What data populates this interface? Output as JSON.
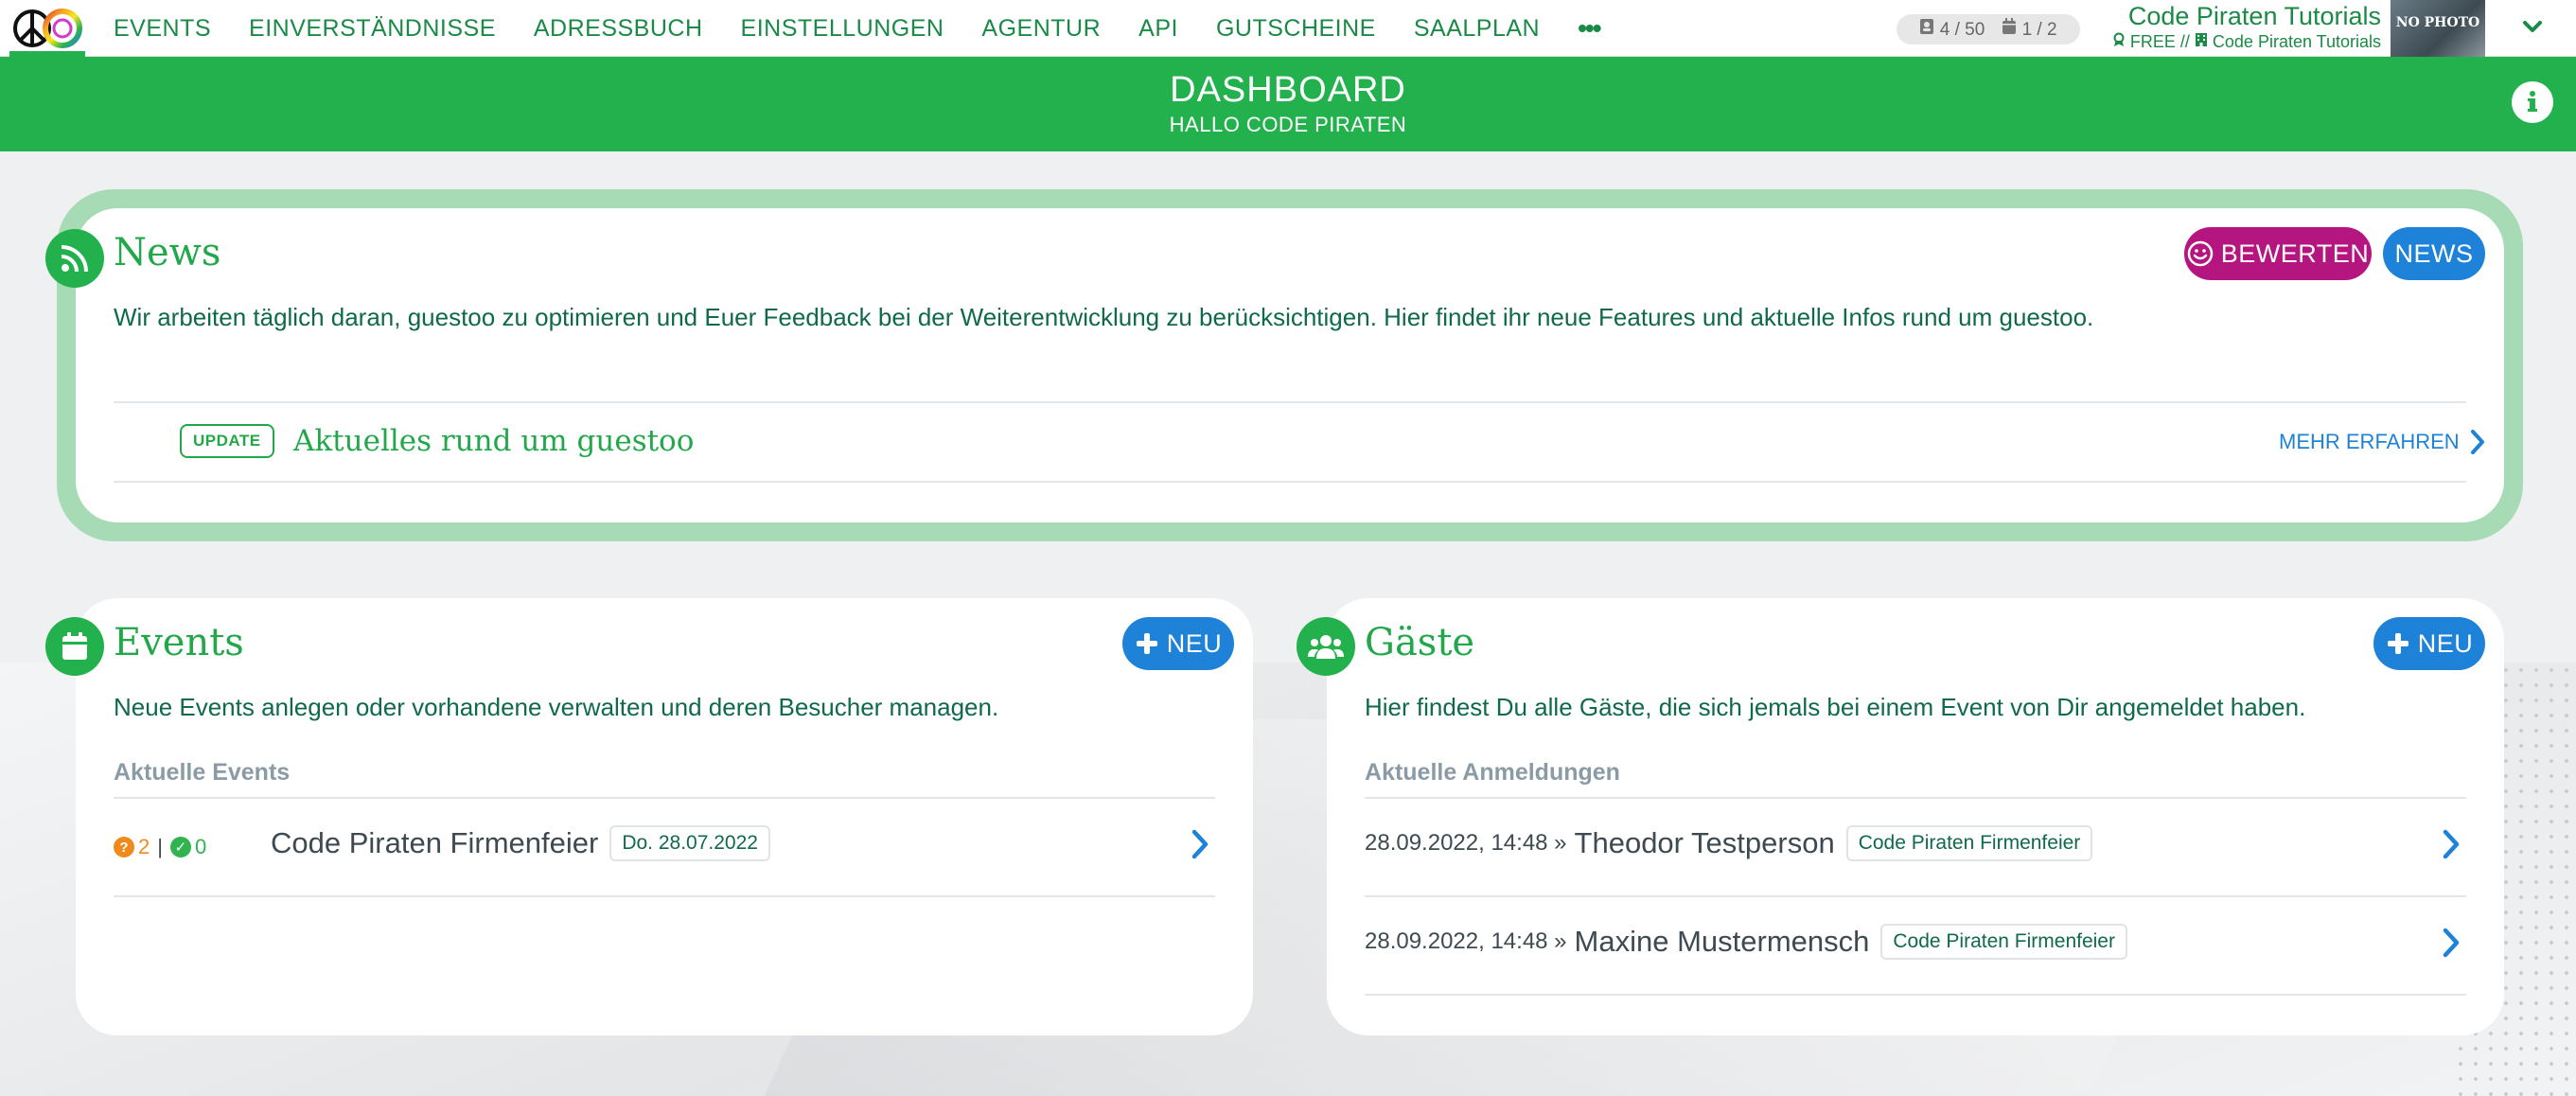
{
  "nav": {
    "items": [
      "EVENTS",
      "EINVERSTÄNDNISSE",
      "ADRESSBUCH",
      "EINSTELLUNGEN",
      "AGENTUR",
      "API",
      "GUTSCHEINE",
      "SAALPLAN"
    ],
    "more": "•••"
  },
  "quota": {
    "contacts": "4 / 50",
    "events": "1 / 2"
  },
  "account": {
    "name": "Code Piraten Tutorials",
    "plan": "FREE //",
    "org": "Code Piraten Tutorials",
    "avatar_text": "NO PHOTO"
  },
  "header": {
    "title": "DASHBOARD",
    "subtitle": "HALLO CODE PIRATEN"
  },
  "news": {
    "title": "News",
    "rate_label": "BEWERTEN",
    "news_label": "NEWS",
    "description": "Wir arbeiten täglich daran, guestoo zu optimieren und Euer Feedback bei der Weiterentwicklung zu berücksichtigen. Hier findet ihr neue Features und aktuelle Infos rund um guestoo.",
    "item": {
      "badge": "UPDATE",
      "title": "Aktuelles rund um guestoo",
      "more": "MEHR ERFAHREN"
    }
  },
  "events": {
    "title": "Events",
    "new_label": "NEU",
    "description": "Neue Events anlegen oder vorhandene verwalten und deren Besucher managen.",
    "section_label": "Aktuelle Events",
    "items": [
      {
        "pending": "2",
        "sep": "|",
        "confirmed": "0",
        "name": "Code Piraten Firmenfeier",
        "date": "Do. 28.07.2022"
      }
    ]
  },
  "guests": {
    "title": "Gäste",
    "new_label": "NEU",
    "description": "Hier findest Du alle Gäste, die sich jemals bei einem Event von Dir angemeldet haben.",
    "section_label": "Aktuelle Anmeldungen",
    "items": [
      {
        "time": "28.09.2022, 14:48 »",
        "name": "Theodor Testperson",
        "event": "Code Piraten Firmenfeier"
      },
      {
        "time": "28.09.2022, 14:48 »",
        "name": "Maxine Mustermensch",
        "event": "Code Piraten Firmenfeier"
      }
    ]
  },
  "colors": {
    "brand_green": "#22b14c",
    "accent_blue": "#1d82d8",
    "accent_magenta": "#b5157f",
    "warning_orange": "#f08a1e"
  },
  "icons": [
    "rss-icon",
    "calendar-icon",
    "users-icon",
    "plus-icon",
    "smile-icon",
    "info-icon",
    "chevron-right-icon",
    "chevron-down-icon",
    "question-circle-icon",
    "check-circle-icon",
    "address-card-icon",
    "calendar-small-icon",
    "award-icon",
    "building-icon"
  ]
}
